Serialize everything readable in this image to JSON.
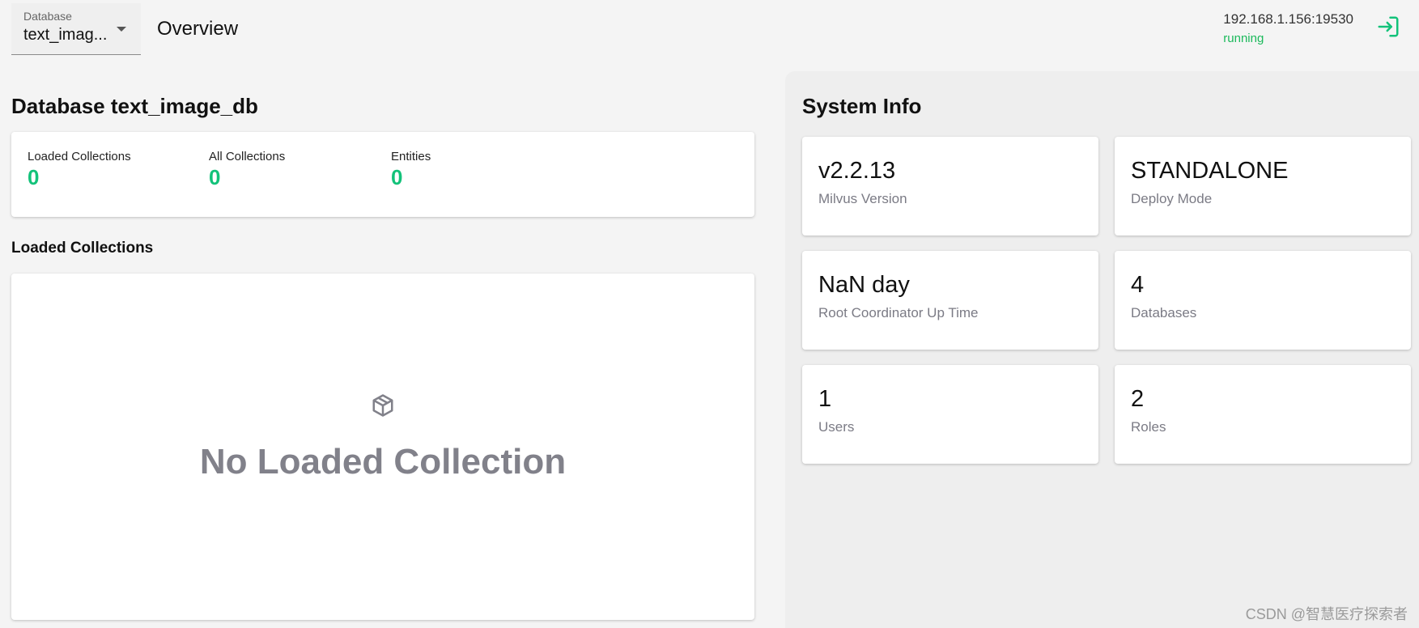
{
  "header": {
    "database_label": "Database",
    "database_value": "text_imag...",
    "page_title": "Overview",
    "server_address": "192.168.1.156:19530",
    "server_status": "running",
    "status_color": "#1bb95b"
  },
  "database": {
    "heading": "Database text_image_db",
    "stats": [
      {
        "label": "Loaded Collections",
        "value": "0"
      },
      {
        "label": "All Collections",
        "value": "0"
      },
      {
        "label": "Entities",
        "value": "0"
      }
    ],
    "loaded_section_title": "Loaded Collections",
    "empty_message": "No Loaded Collection"
  },
  "system_info": {
    "heading": "System Info",
    "cards": [
      {
        "value": "v2.2.13",
        "label": "Milvus Version"
      },
      {
        "value": "STANDALONE",
        "label": "Deploy Mode"
      },
      {
        "value": "NaN day",
        "label": "Root Coordinator Up Time"
      },
      {
        "value": "4",
        "label": "Databases"
      },
      {
        "value": "1",
        "label": "Users"
      },
      {
        "value": "2",
        "label": "Roles"
      }
    ]
  },
  "watermark": "CSDN @智慧医疗探索者",
  "icons": {
    "logout": "logout-icon",
    "empty_box": "box-icon",
    "caret": "chevron-down-icon"
  },
  "colors": {
    "accent": "#13c27a",
    "muted_text": "#81818a"
  }
}
